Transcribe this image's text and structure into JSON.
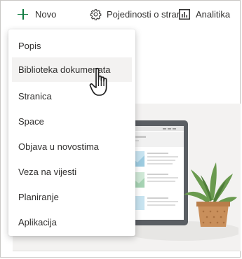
{
  "commandbar": {
    "new_label": "Novo",
    "details_label": "Pojedinosti o stranici",
    "analytics_label": "Analitika"
  },
  "menu": {
    "items": [
      {
        "label": "Popis"
      },
      {
        "label": "Biblioteka dokumenata",
        "hovered": true
      },
      {
        "label": "Stranica"
      },
      {
        "label": "Space"
      },
      {
        "label": "Objava u novostima"
      },
      {
        "label": "Veza na vijesti"
      },
      {
        "label": "Planiranje"
      },
      {
        "label": "Aplikacija"
      }
    ]
  },
  "icons": {
    "new": "plus-icon",
    "details": "gear-icon",
    "analytics": "analytics-icon",
    "cursor": "hand-pointer-icon"
  },
  "colors": {
    "accent": "#107c41",
    "menu_hover": "#f3f2f1",
    "text": "#323130",
    "plant": "#6a9a4f",
    "pot": "#c98f5b"
  }
}
